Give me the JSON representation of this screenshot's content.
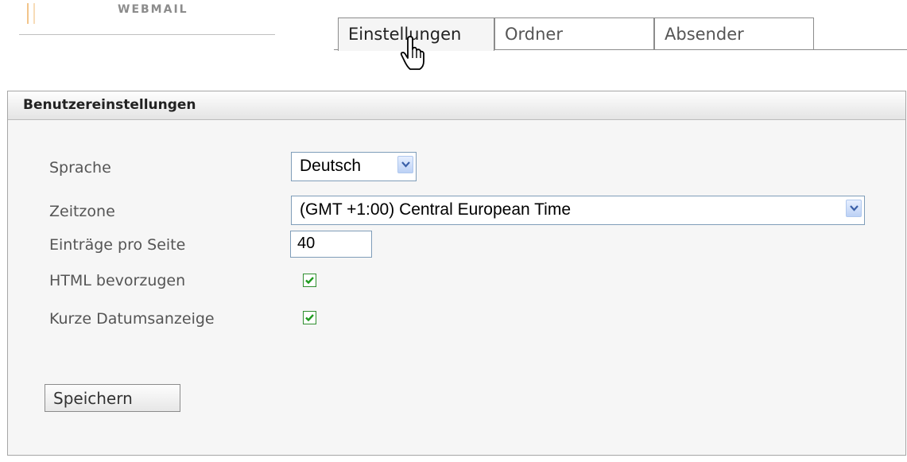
{
  "logo": {
    "text": "WEBMAIL"
  },
  "tabs": [
    {
      "label": "Einstellungen",
      "active": true
    },
    {
      "label": "Ordner",
      "active": false
    },
    {
      "label": "Absender",
      "active": false
    }
  ],
  "panel": {
    "title": "Benutzereinstellungen",
    "language": {
      "label": "Sprache",
      "value": "Deutsch"
    },
    "timezone": {
      "label": "Zeitzone",
      "value": "(GMT +1:00) Central European Time"
    },
    "entries": {
      "label": "Einträge pro Seite",
      "value": "40"
    },
    "html": {
      "label": "HTML bevorzugen",
      "checked": true
    },
    "shortdate": {
      "label": "Kurze Datumsanzeige",
      "checked": true
    },
    "save_label": "Speichern"
  },
  "colors": {
    "panel_border": "#a6a6a6",
    "checkbox_green": "#2f8e2f",
    "select_border": "#7f9db9"
  }
}
